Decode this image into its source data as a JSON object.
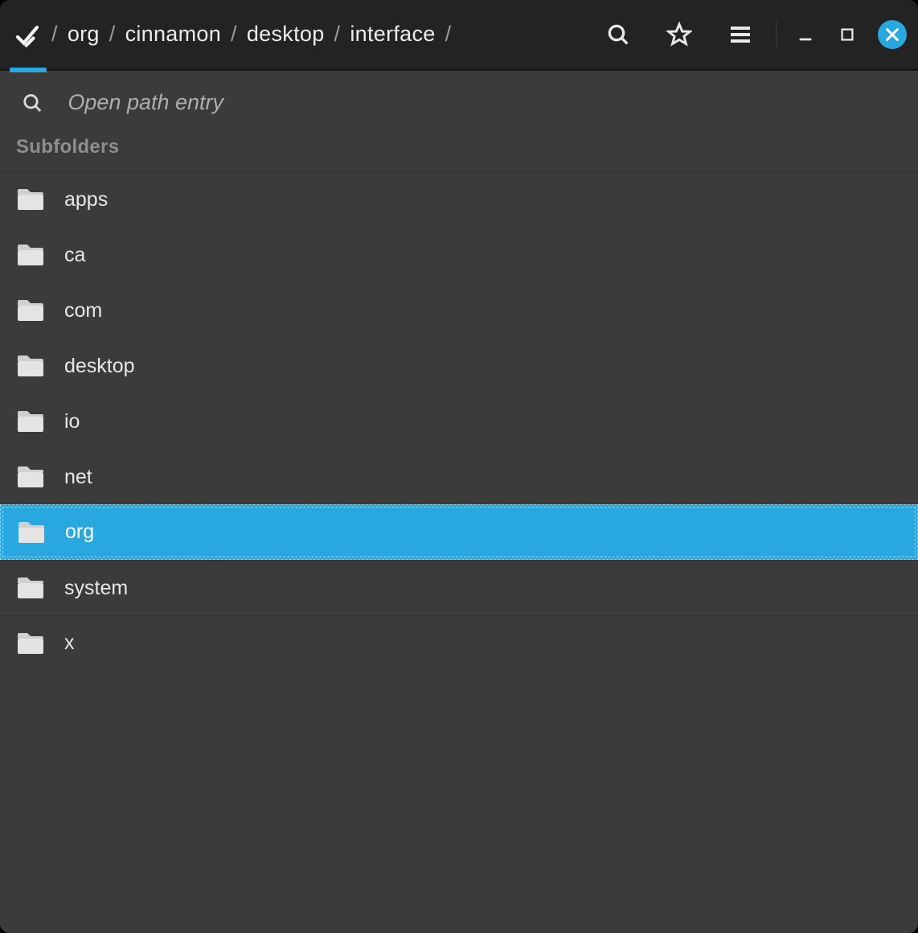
{
  "breadcrumb": {
    "segments": [
      "org",
      "cinnamon",
      "desktop",
      "interface"
    ]
  },
  "search": {
    "placeholder": "Open path entry"
  },
  "section": {
    "title": "Subfolders"
  },
  "subfolders": [
    {
      "label": "apps",
      "selected": false
    },
    {
      "label": "ca",
      "selected": false
    },
    {
      "label": "com",
      "selected": false
    },
    {
      "label": "desktop",
      "selected": false
    },
    {
      "label": "io",
      "selected": false
    },
    {
      "label": "net",
      "selected": false
    },
    {
      "label": "org",
      "selected": true
    },
    {
      "label": "system",
      "selected": false
    },
    {
      "label": "x",
      "selected": false
    }
  ],
  "colors": {
    "accent": "#29a8e0"
  }
}
